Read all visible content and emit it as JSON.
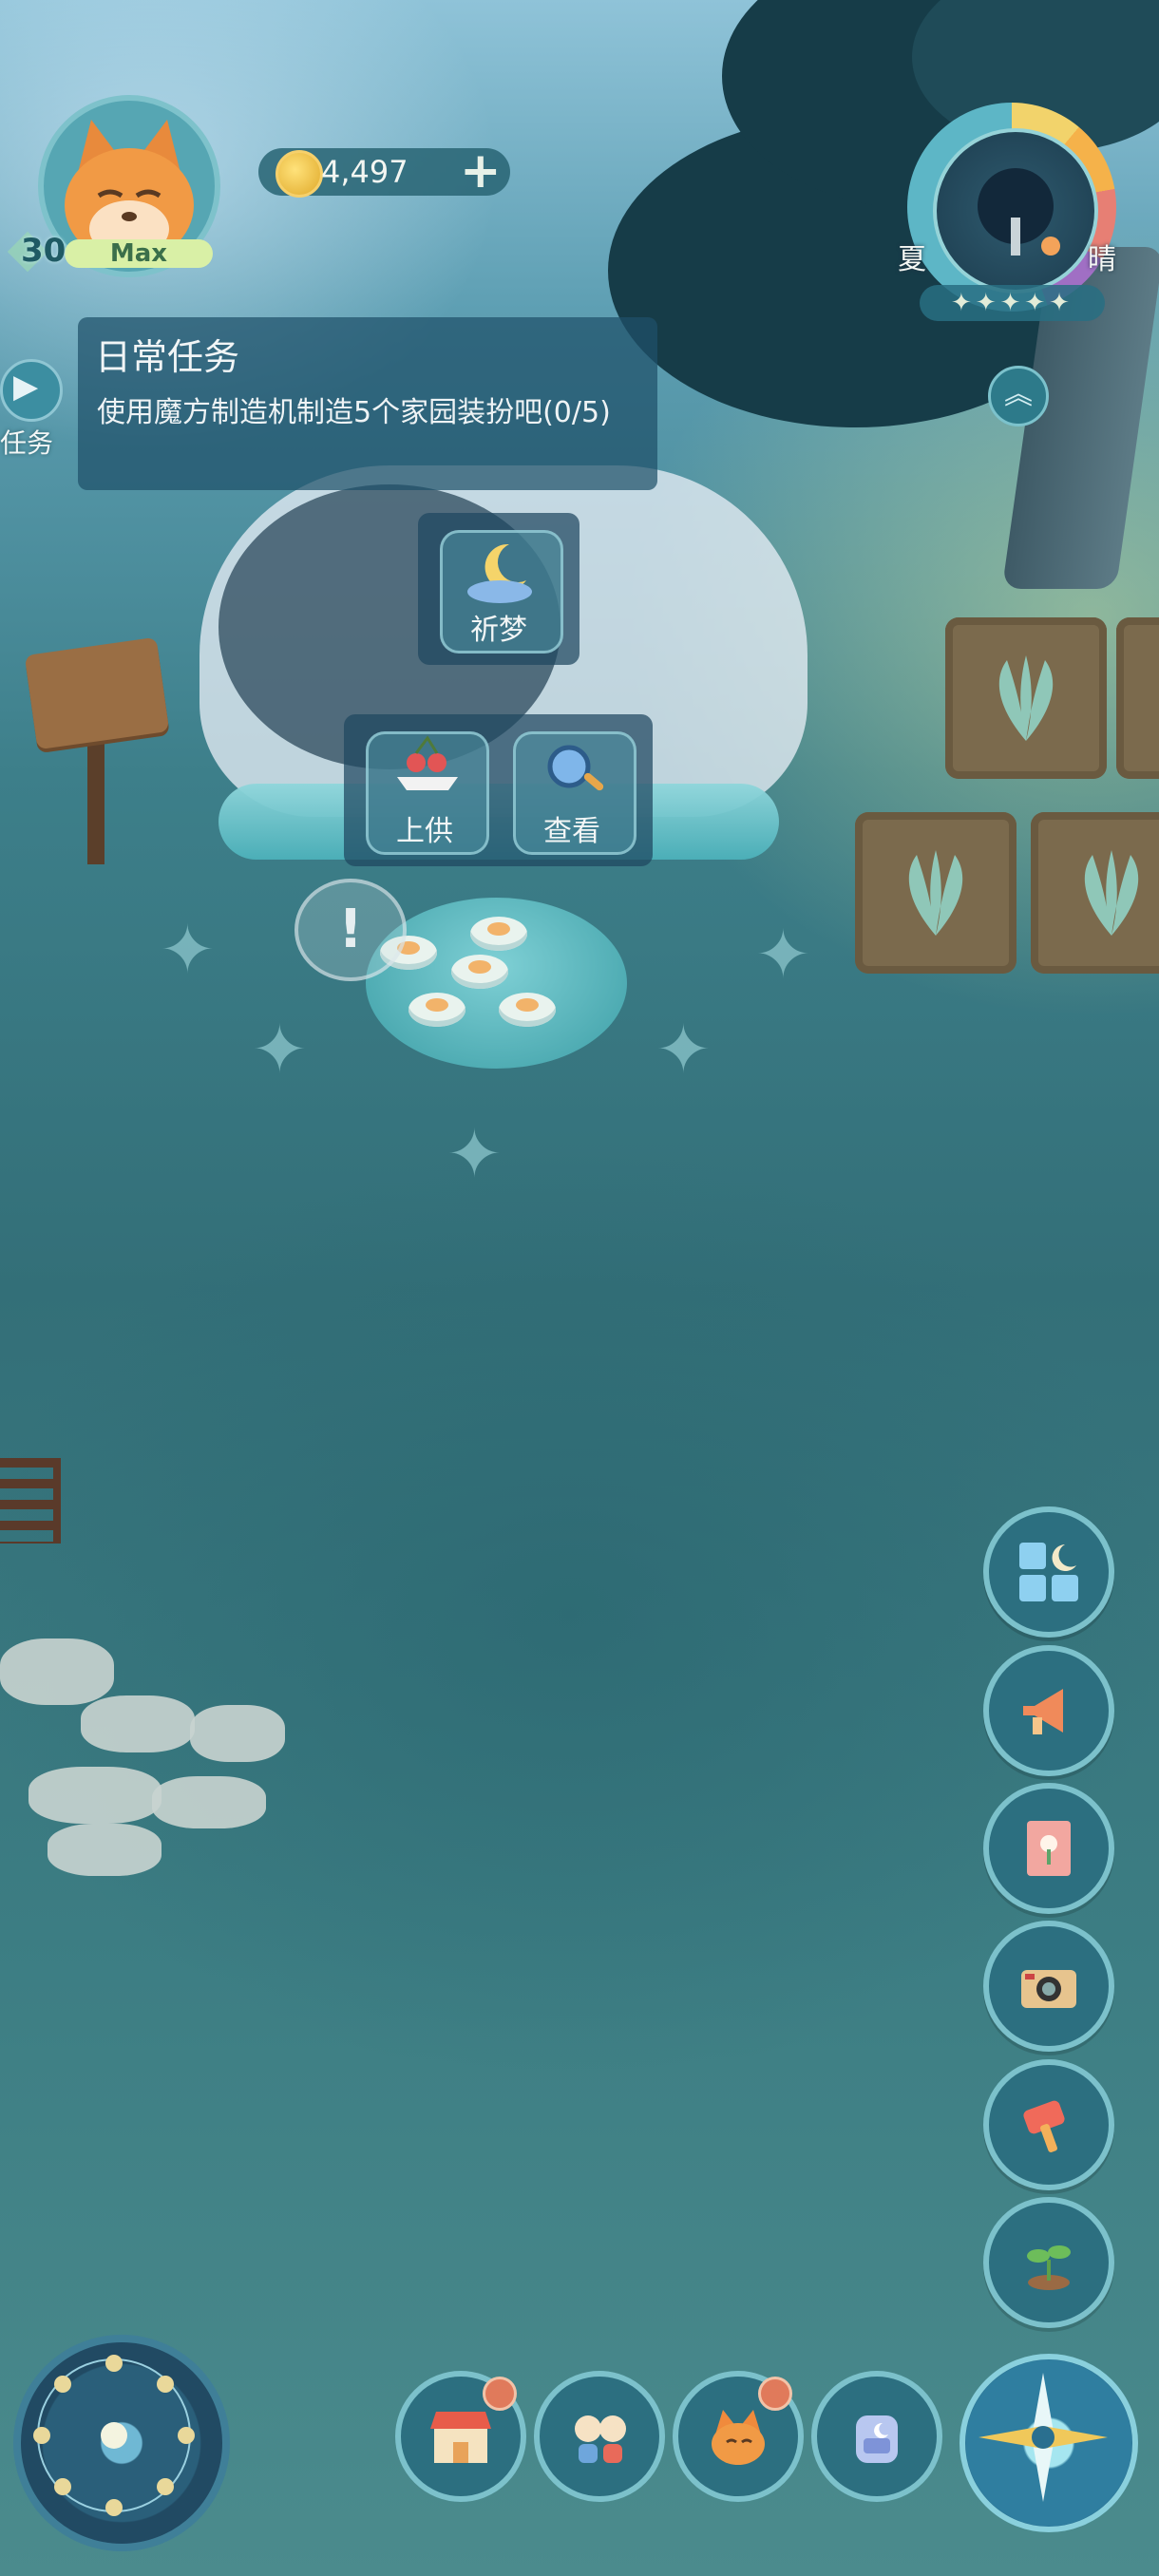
{
  "player": {
    "level": "30",
    "level_status": "Max",
    "avatar_icon": "fox-avatar-icon"
  },
  "currency": {
    "coins": "4,497",
    "coin_icon": "gold-coin-icon",
    "add_label": "+"
  },
  "daily_task": {
    "title": "日常任务",
    "description": "使用魔方制造机制造5个家园装扮吧(0/5)",
    "tab_label": "任务",
    "tab_arrow": "▶"
  },
  "weather": {
    "season": "夏",
    "condition": "晴",
    "stars": "✦✦✦✦✦",
    "expand_label": "︽"
  },
  "object_actions": {
    "pray": {
      "label": "祈梦",
      "icon": "moon-cloud-icon"
    },
    "offer": {
      "label": "上供",
      "icon": "cherry-offering-icon"
    },
    "inspect": {
      "label": "查看",
      "icon": "magnifier-icon"
    }
  },
  "alert_mark": "!",
  "side_menu": [
    {
      "name": "catalog",
      "icon": "blocks-moon-icon"
    },
    {
      "name": "announcement",
      "icon": "megaphone-icon"
    },
    {
      "name": "handbook",
      "icon": "flower-book-icon"
    },
    {
      "name": "camera",
      "icon": "camera-icon"
    },
    {
      "name": "event",
      "icon": "hammer-event-icon"
    },
    {
      "name": "plant",
      "icon": "sprout-icon"
    }
  ],
  "bottom_menu": [
    {
      "name": "shop",
      "icon": "shop-icon",
      "badge": true
    },
    {
      "name": "friends",
      "icon": "friends-icon",
      "badge": false
    },
    {
      "name": "character",
      "icon": "fox-icon",
      "badge": true
    },
    {
      "name": "backpack",
      "icon": "backpack-icon",
      "badge": false
    }
  ],
  "colors": {
    "panel": "#1e5069",
    "accent": "#7cc1cb",
    "badge": "#e07a5b",
    "coin": "#f6d06b"
  }
}
